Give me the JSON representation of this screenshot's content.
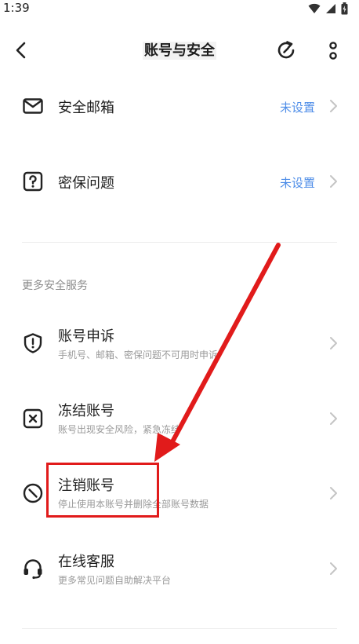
{
  "status_bar": {
    "time": "1:39"
  },
  "header": {
    "title": "账号与安全"
  },
  "rows": [
    {
      "label": "安全邮箱",
      "value": "未设置"
    },
    {
      "label": "密保问题",
      "value": "未设置"
    }
  ],
  "section": {
    "title": "更多安全服务"
  },
  "services": [
    {
      "label": "账号申诉",
      "sub": "手机号、邮箱、密保问题不可用时申诉"
    },
    {
      "label": "冻结账号",
      "sub": "账号出现安全风险，紧急冻结"
    },
    {
      "label": "注销账号",
      "sub": "停止使用本账号并删除全部账号数据"
    },
    {
      "label": "在线客服",
      "sub": "更多常见问题自助解决平台"
    }
  ],
  "annotation": {
    "color": "#e11b1b"
  },
  "colors": {
    "accent": "#4f8ee8",
    "annotation": "#e11b1b"
  },
  "icons": {
    "email": "envelope-icon",
    "question": "question-box-icon",
    "appeal": "shield-exclamation-icon",
    "freeze": "x-box-icon",
    "cancel": "no-entry-icon",
    "support": "headset-icon"
  }
}
